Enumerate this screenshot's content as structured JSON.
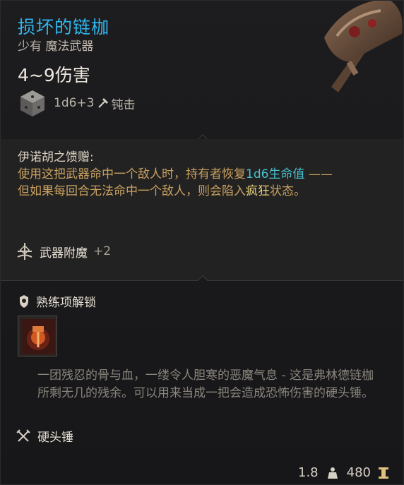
{
  "item": {
    "name": "损坏的链枷",
    "rarity": "少有 魔法武器",
    "damage": "4~9伤害",
    "dice_formula": "1d6+3",
    "damage_type": "钝击",
    "colors": {
      "name": "#30b7ef",
      "passive": "#c9a160",
      "highlight_blue": "#48c2cf",
      "highlight_yellow": "#e6d07a"
    }
  },
  "passive": {
    "title": "伊诺胡之馈赠:",
    "line1_before": "使用这把武器命中一个敌人时，持有者恢复",
    "line1_highlight": "1d6生命值",
    "line1_after": " ——",
    "line2_before": "但如果每回合无法命中一个敌人，则会陷入",
    "line2_highlight": "疯狂",
    "line2_after": "状态。"
  },
  "enchantment": {
    "label": "武器附魔",
    "value": "+2"
  },
  "proficiency": {
    "label": "熟练项解锁"
  },
  "flavor_text": "一团残忍的骨与血，一缕令人胆寒的恶魔气息 - 这是弗林德链枷所剩无几的残余。可以用来当成一把会造成恐怖伤害的硬头锤。",
  "weapon_type": "硬头锤",
  "footer": {
    "weight": "1.8",
    "value": "480"
  },
  "icons": {
    "dice": "d6-dice-icon",
    "blunt": "blunt-damage-icon",
    "enchant": "enchantment-icon",
    "proficiency": "proficiency-unlock-icon",
    "action": "fiendish-action-icon",
    "weapon_type": "crossed-weapons-icon",
    "weight": "weight-icon",
    "gold": "gold-icon",
    "item": "flail-hammer-icon"
  }
}
